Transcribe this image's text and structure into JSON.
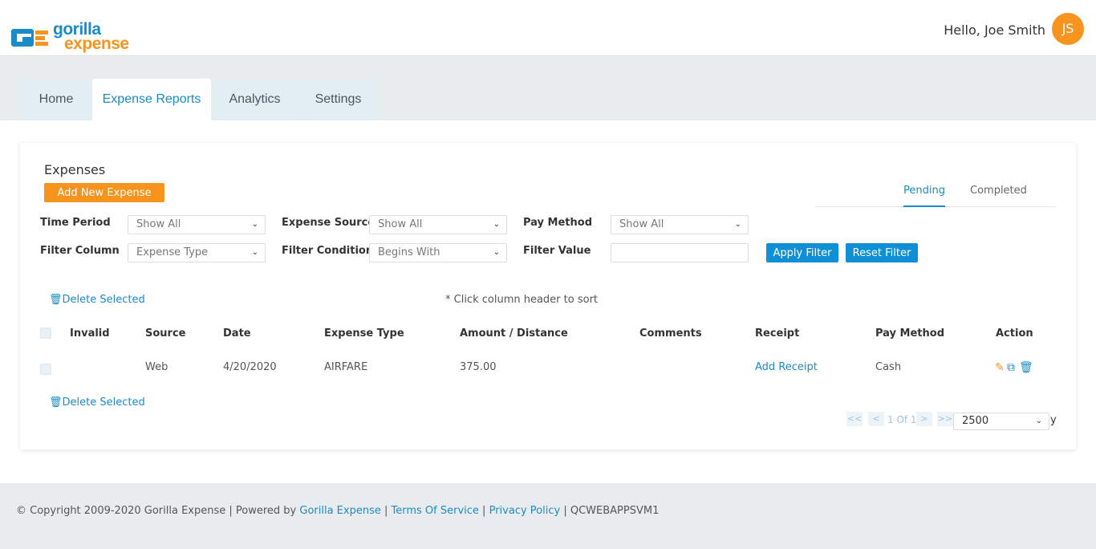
{
  "brand": {
    "word1": "gorilla",
    "word2": "expense"
  },
  "header": {
    "greeting": "Hello, Joe Smith",
    "initials": "JS"
  },
  "nav": {
    "tabs": [
      "Home",
      "Expense Reports",
      "Analytics",
      "Settings"
    ]
  },
  "expenses": {
    "title": "Expenses",
    "add_button": "Add New Expense",
    "status_tabs": [
      "Pending",
      "Completed"
    ],
    "filters": {
      "time_period_label": "Time Period",
      "time_period_value": "Show All",
      "expense_source_label": "Expense Source",
      "expense_source_value": "Show All",
      "pay_method_label": "Pay Method",
      "pay_method_value": "Show All",
      "filter_column_label": "Filter Column",
      "filter_column_value": "Expense Type",
      "filter_condition_label": "Filter Condition",
      "filter_condition_value": "Begins With",
      "filter_value_label": "Filter Value",
      "filter_value": "",
      "apply_button": "Apply Filter",
      "reset_button": "Reset Filter"
    },
    "delete_selected": "Delete Selected",
    "sort_note": "* Click column header to sort",
    "columns": [
      "Invalid",
      "Source",
      "Date",
      "Expense Type",
      "Amount / Distance",
      "Comments",
      "Receipt",
      "Pay Method",
      "Action"
    ],
    "rows": [
      {
        "invalid": "",
        "source": "Web",
        "date": "4/20/2020",
        "expense_type": "AIRFARE",
        "amount": "375.00",
        "comments": "",
        "receipt": "Add Receipt",
        "pay_method": "Cash"
      }
    ],
    "pager": {
      "first": "<<",
      "prev": "<",
      "page_text": "1 Of 1",
      "next": ">",
      "last": ">>",
      "page_size": "2500",
      "trailing": "y"
    }
  },
  "footer": {
    "copyright": "© Copyright 2009-2020 Gorilla Expense | Powered by ",
    "powered_link": "Gorilla Expense",
    "sep1": " | ",
    "terms": "Terms Of Service",
    "sep2": " | ",
    "privacy": "Privacy Policy",
    "sep3": " | ",
    "server": "QCWEBAPPSVM1"
  },
  "colors": {
    "accent_orange": "#f7941d",
    "accent_blue": "#1b8bc6",
    "button_blue": "#0f8fd6"
  }
}
